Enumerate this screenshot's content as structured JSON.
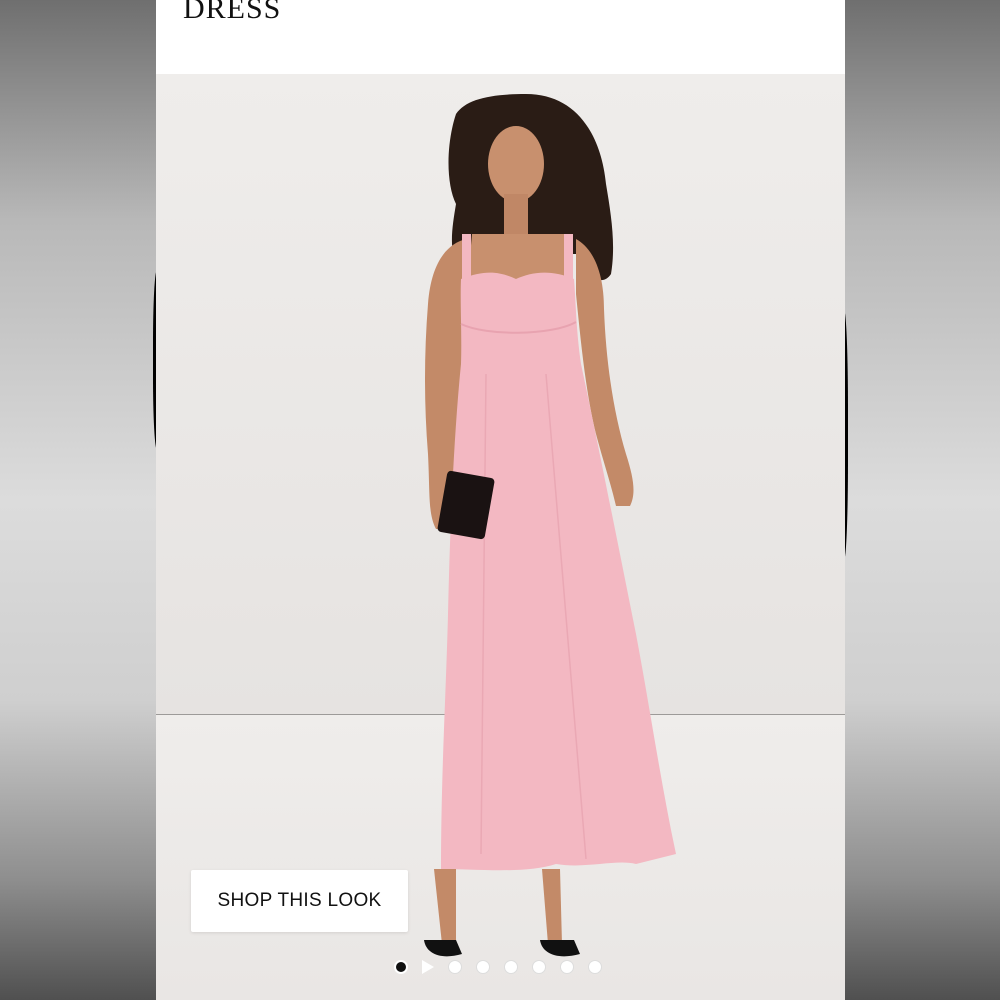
{
  "header": {
    "title": "DRESS"
  },
  "gallery": {
    "image": {
      "subject": "model in pink dress holding black clutch",
      "dress_color": "#f3b8c2",
      "clutch_color": "#1a1212"
    },
    "shop_button_label": "SHOP THIS LOOK",
    "carousel": {
      "total_slides": 8,
      "active_index": 0,
      "video_slide_index": 1
    }
  }
}
